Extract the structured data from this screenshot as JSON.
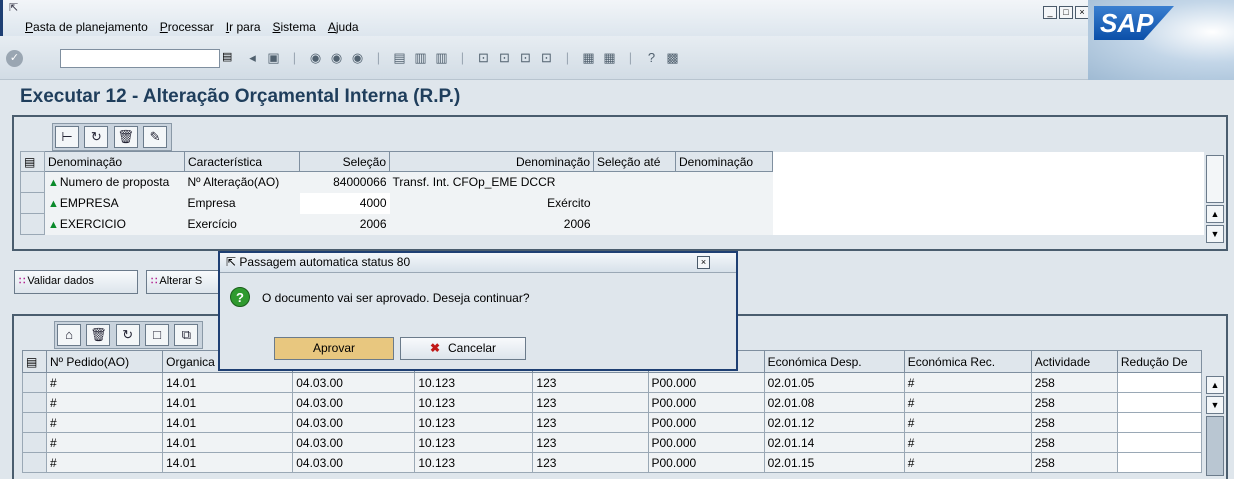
{
  "menubar": {
    "items": [
      "Pasta de planejamento",
      "Processar",
      "Ir para",
      "Sistema",
      "Ajuda"
    ]
  },
  "toolbar": {
    "command_value": ""
  },
  "page": {
    "title": "Executar 12 - Alteração Orçamental Interna (R.P.)"
  },
  "selection": {
    "columns": [
      "Denominação",
      "Característica",
      "Seleção",
      "Denominação",
      "Seleção até",
      "Denominação"
    ],
    "rows": [
      {
        "denominacao": "Numero de proposta",
        "caracteristica": "Nº Alteração(AO)",
        "selecao": "84000066",
        "denominacao2": "Transf. Int. CFOp_EME DCCR"
      },
      {
        "denominacao": "EMPRESA",
        "caracteristica": "Empresa",
        "selecao": "4000",
        "denominacao2": "Exército"
      },
      {
        "denominacao": "EXERCICIO",
        "caracteristica": "Exercício",
        "selecao": "2006",
        "denominacao2": "2006"
      }
    ]
  },
  "actions": {
    "validate": "Validar dados",
    "alter": "Alterar S"
  },
  "items": {
    "columns": [
      "Nº Pedido(AO)",
      "Organica",
      "",
      "",
      "",
      "",
      "Económica Desp.",
      "Económica Rec.",
      "Actividade",
      "Redução De"
    ],
    "rows": [
      [
        "#",
        "14.01",
        "04.03.00",
        "10.123",
        "123",
        "P00.000",
        "02.01.05",
        "#",
        "258",
        ""
      ],
      [
        "#",
        "14.01",
        "04.03.00",
        "10.123",
        "123",
        "P00.000",
        "02.01.08",
        "#",
        "258",
        ""
      ],
      [
        "#",
        "14.01",
        "04.03.00",
        "10.123",
        "123",
        "P00.000",
        "02.01.12",
        "#",
        "258",
        ""
      ],
      [
        "#",
        "14.01",
        "04.03.00",
        "10.123",
        "123",
        "P00.000",
        "02.01.14",
        "#",
        "258",
        ""
      ],
      [
        "#",
        "14.01",
        "04.03.00",
        "10.123",
        "123",
        "P00.000",
        "02.01.15",
        "#",
        "258",
        ""
      ]
    ]
  },
  "dialog": {
    "title": "Passagem automatica status 80",
    "message": "O documento vai ser aprovado. Deseja continuar?",
    "approve": "Aprovar",
    "cancel": "Cancelar"
  },
  "colors": {
    "title": "#1f3e5c",
    "approve_button": "#e8c77f",
    "window_border": "#1e3f73"
  }
}
